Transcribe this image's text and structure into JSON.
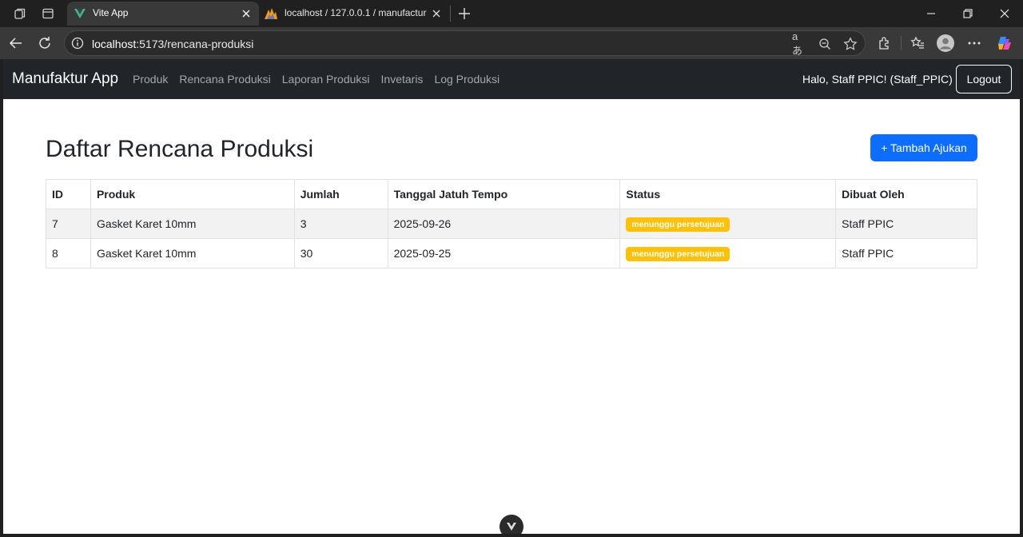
{
  "browser": {
    "tabs": [
      {
        "title": "Vite App",
        "favicon": "vue-logo-icon",
        "active": true
      },
      {
        "title": "localhost / 127.0.0.1 / manufactur",
        "favicon": "phpmyadmin-icon",
        "active": false
      }
    ],
    "url_host": "localhost",
    "url_rest": ":5173/rencana-produksi"
  },
  "nav": {
    "brand": "Manufaktur App",
    "links": [
      "Produk",
      "Rencana Produksi",
      "Laporan Produksi",
      "Invetaris",
      "Log Produksi"
    ],
    "greeting": "Halo, Staff PPIC! (Staff_PPIC)",
    "logout_label": "Logout"
  },
  "page": {
    "title": "Daftar Rencana Produksi",
    "add_button": "+ Tambah Ajukan"
  },
  "table": {
    "headers": [
      "ID",
      "Produk",
      "Jumlah",
      "Tanggal Jatuh Tempo",
      "Status",
      "Dibuat Oleh"
    ],
    "rows": [
      {
        "id": "7",
        "produk": "Gasket Karet 10mm",
        "jumlah": "3",
        "tanggal": "2025-09-26",
        "status": "menunggu persetujuan",
        "dibuat_oleh": "Staff PPIC"
      },
      {
        "id": "8",
        "produk": "Gasket Karet 10mm",
        "jumlah": "30",
        "tanggal": "2025-09-25",
        "status": "menunggu persetujuan",
        "dibuat_oleh": "Staff PPIC"
      }
    ]
  },
  "colors": {
    "navbar": "#212529",
    "primary": "#0d6efd",
    "warning_badge": "#ffc107"
  }
}
